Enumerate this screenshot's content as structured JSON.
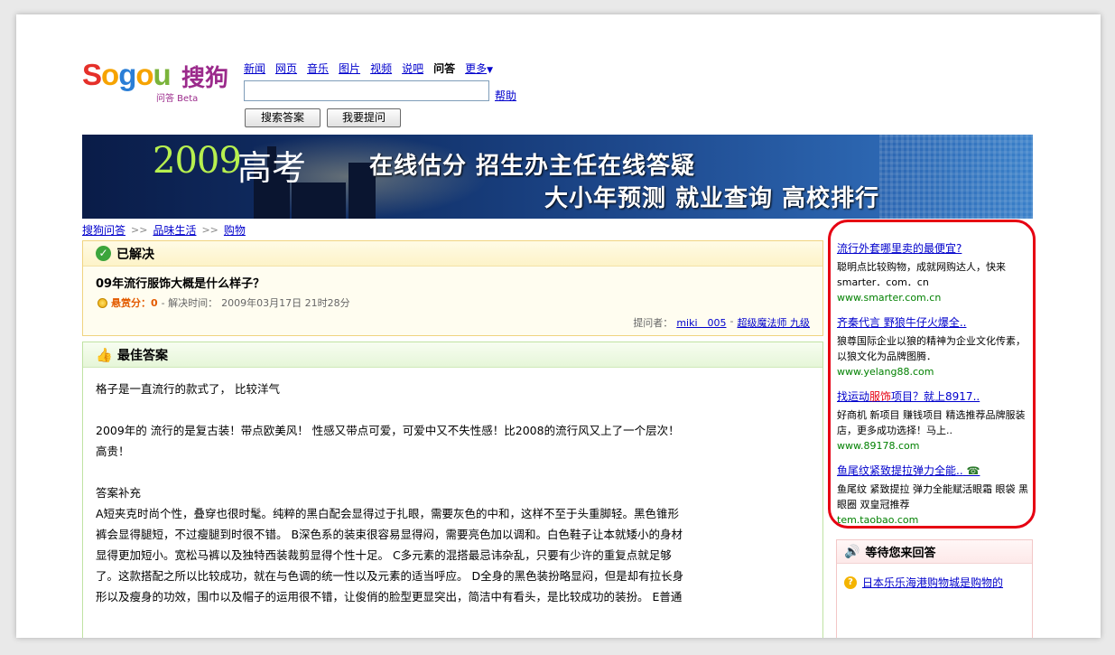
{
  "header": {
    "logo_word": [
      "S",
      "o",
      "g",
      "o",
      "u"
    ],
    "logo_cn": "搜狗",
    "logo_sub": "问答 Beta",
    "nav": [
      {
        "label": "新闻",
        "active": false
      },
      {
        "label": "网页",
        "active": false
      },
      {
        "label": "音乐",
        "active": false
      },
      {
        "label": "图片",
        "active": false
      },
      {
        "label": "视频",
        "active": false
      },
      {
        "label": "说吧",
        "active": false
      },
      {
        "label": "问答",
        "active": true
      },
      {
        "label": "更多",
        "active": false
      }
    ],
    "search_value": "",
    "help_label": "帮助",
    "btn_search": "搜索答案",
    "btn_ask": "我要提问"
  },
  "banner": {
    "year": "2009",
    "title": "高考",
    "line1": "在线估分 招生办主任在线答疑",
    "line2": "大小年预测 就业查询 高校排行"
  },
  "breadcrumb": [
    "搜狗问答",
    "品味生活",
    "购物"
  ],
  "breadcrumb_sep": ">>",
  "question": {
    "status": "已解决",
    "title": "09年流行服饰大概是什么样子？",
    "bounty_label": "悬赏分：0",
    "solved_label": "- 解决时间：",
    "solved_time": "2009年03月17日 21时28分",
    "asker_label": "提问者：",
    "asker_name": "miki＿005",
    "asker_sep": "-",
    "asker_rank": "超级魔法师 九级"
  },
  "best_answer": {
    "heading": "最佳答案",
    "line1": "格子是一直流行的款式了， 比较洋气",
    "line2": "2009年的 流行的是复古装！带点欧美风！ 性感又带点可爱，可爱中又不失性感！比2008的流行风又上了一个层次！",
    "line3": "高贵！",
    "supplement_label": "答案补充",
    "para1": "A短夹克时尚个性，叠穿也很时髦。纯粹的黑白配会显得过于扎眼，需要灰色的中和，这样不至于头重脚轻。黑色锥形",
    "para2": "裤会显得腿短，不过瘦腿到时很不错。 B深色系的装束很容易显得闷，需要亮色加以调和。白色鞋子让本就矮小的身材",
    "para3": "显得更加短小。宽松马裤以及独特西装裁剪显得个性十足。 C多元素的混搭最忌讳杂乱，只要有少许的重复点就足够",
    "para4": "了。这款搭配之所以比较成功，就在与色调的统一性以及元素的适当呼应。 D全身的黑色装扮略显闷，但是却有拉长身",
    "para5": "形以及瘦身的功效，围巾以及帽子的运用很不错，让俊俏的脸型更显突出，简洁中有看头，是比较成功的装扮。 E普通"
  },
  "ads": [
    {
      "title": "流行外套哪里卖的最便宜?",
      "title_hl": "",
      "title_rest": "",
      "desc": "聪明点比较购物，成就网购达人，快来smarter．com．cn",
      "url": "www.smarter.com.cn"
    },
    {
      "title": "齐秦代言 野狼牛仔火爆全..",
      "title_hl": "",
      "title_rest": "",
      "desc": "狼尊国际企业以狼的精神为企业文化传素，以狼文化为品牌图腾．",
      "url": "www.yelang88.com"
    },
    {
      "title": "找运动",
      "title_hl": "服饰",
      "title_rest": "项目？就上8917..",
      "desc": "好商机 新项目 赚钱项目 精选推荐品牌服装店，更多成功选择！马上..",
      "url": "www.89178.com"
    },
    {
      "title": "鱼尾纹紧致提拉弹力全能..",
      "title_hl": "",
      "title_rest": "",
      "desc": "鱼尾纹 紧致提拉 弹力全能赋活眼霜 眼袋 黑眼圈 双皇冠推荐",
      "url": "tem.taobao.com"
    }
  ],
  "waiting": {
    "heading": "等待您来回答",
    "item": "日本乐乐海港购物城是购物的"
  },
  "colors": {
    "link": "#0000cc",
    "ad_border": "#e60012",
    "bounty": "#e35b00",
    "url_green": "#008000"
  }
}
